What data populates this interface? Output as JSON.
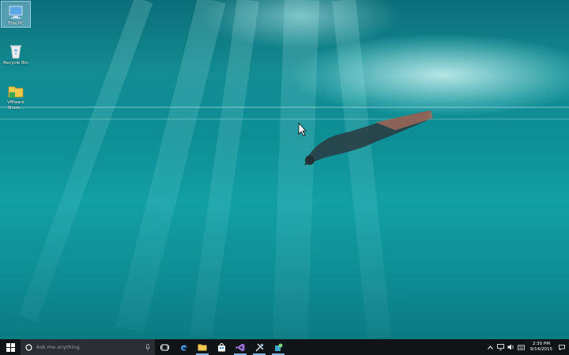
{
  "desktop": {
    "icons": [
      {
        "label": "This PC",
        "icon": "this-pc-icon"
      },
      {
        "label": "Recycle Bin",
        "icon": "recycle-bin-icon"
      },
      {
        "label": "VMware Share...",
        "icon": "vmware-shared-folder-icon"
      }
    ]
  },
  "taskbar": {
    "start_icon": "windows-start-icon",
    "search_placeholder": "Ask me anything",
    "pinned": [
      {
        "name": "task-view",
        "icon": "task-view-icon"
      },
      {
        "name": "edge",
        "icon": "edge-icon"
      },
      {
        "name": "file-explorer",
        "icon": "file-explorer-icon"
      },
      {
        "name": "store",
        "icon": "store-icon"
      },
      {
        "name": "visual-studio",
        "icon": "visual-studio-icon"
      },
      {
        "name": "tools",
        "icon": "tools-icon"
      },
      {
        "name": "app",
        "icon": "app-icon"
      }
    ],
    "tray": {
      "time": "2:30 PM",
      "date": "9/14/2015"
    }
  },
  "colors": {
    "taskbar_bg": "#111417",
    "search_bg": "#2a2d31",
    "water": "#0e8e95",
    "accent": "#7fb3e0"
  }
}
